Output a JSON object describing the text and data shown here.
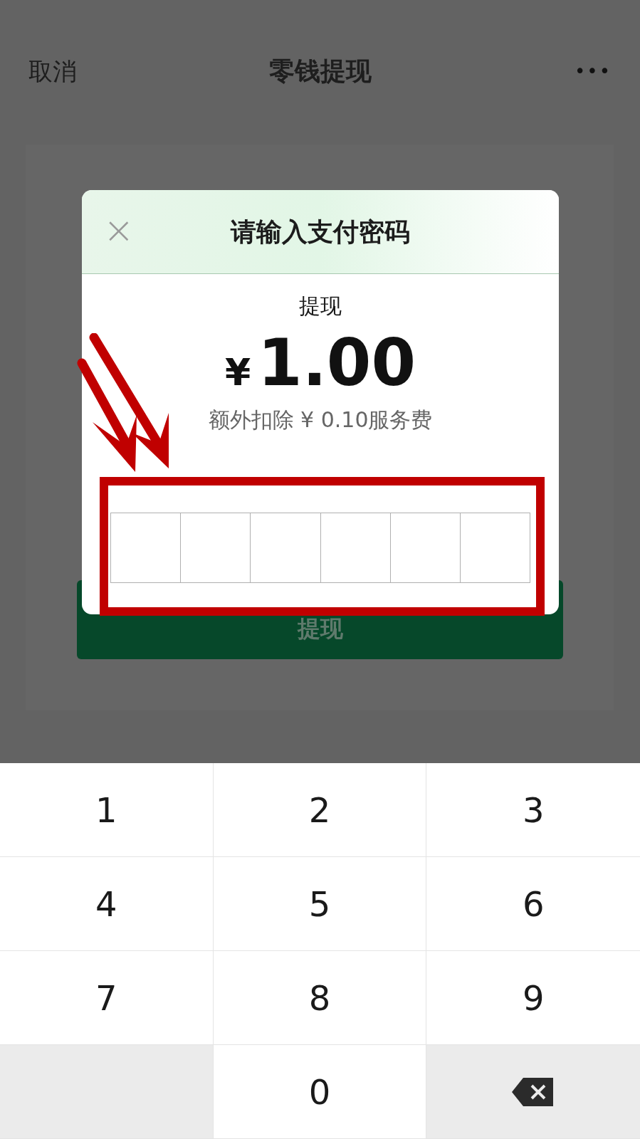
{
  "nav": {
    "cancel": "取消",
    "title": "零钱提现",
    "more": "•••"
  },
  "card": {
    "button": "提现"
  },
  "dialog": {
    "title": "请输入支付密码",
    "close": "×",
    "label": "提现",
    "currency": "¥",
    "amount": "1.00",
    "fee": "额外扣除 ¥ 0.10服务费",
    "digits": [
      {
        "filled": false
      },
      {
        "filled": false
      },
      {
        "filled": false
      },
      {
        "filled": false
      },
      {
        "filled": false
      },
      {
        "filled": false
      }
    ]
  },
  "keypad": [
    {
      "kind": "digit",
      "label": "1"
    },
    {
      "kind": "digit",
      "label": "2"
    },
    {
      "kind": "digit",
      "label": "3"
    },
    {
      "kind": "digit",
      "label": "4"
    },
    {
      "kind": "digit",
      "label": "5"
    },
    {
      "kind": "digit",
      "label": "6"
    },
    {
      "kind": "digit",
      "label": "7"
    },
    {
      "kind": "digit",
      "label": "8"
    },
    {
      "kind": "digit",
      "label": "9"
    },
    {
      "kind": "blank"
    },
    {
      "kind": "digit",
      "label": "0"
    },
    {
      "kind": "backspace"
    }
  ]
}
